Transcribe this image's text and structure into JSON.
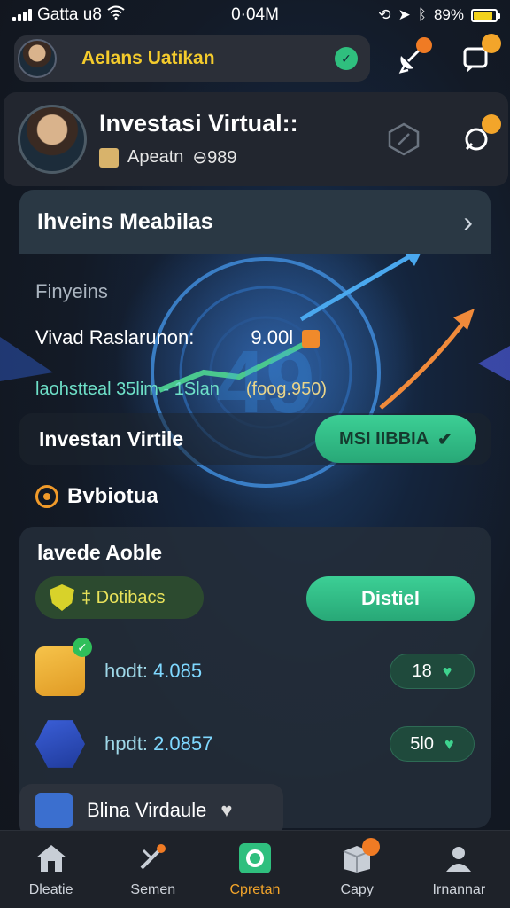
{
  "status_bar": {
    "carrier": "Gatta u8",
    "time": "0·04M",
    "battery_text": "89%",
    "battery_level": 0.89
  },
  "user": {
    "name": "Aelans Uatikan"
  },
  "profile": {
    "title": "Investasi Virtual::",
    "subtitle": "Apeatn",
    "code": "⊖989"
  },
  "panel": {
    "header_title": "Ihveins Meabilas",
    "subtitle": "Finyeins",
    "row1_label": "Vivad Raslarunon:",
    "row1_value": "9.00l",
    "row2_label": "laohstteal 35lim - 1Slan",
    "row2_value": "(foog.950)"
  },
  "invest": {
    "label": "Investan Virtile",
    "button_label": "MSI IIBBIA"
  },
  "section": {
    "title": "Bvbiotua"
  },
  "list": {
    "title": "lavede Aoble",
    "category_label": "‡ Dotibacs",
    "action_label": "Distiel",
    "items": [
      {
        "label": "hodt:",
        "value": "4.085",
        "badge": "18"
      },
      {
        "label": "hpdt:",
        "value": "2.0857",
        "badge": "5l0"
      }
    ]
  },
  "bottom_item": {
    "label": "Blina Virdaule"
  },
  "tabs": [
    {
      "label": "Dleatie",
      "icon": "home-icon"
    },
    {
      "label": "Semen",
      "icon": "tools-icon"
    },
    {
      "label": "Cpretan",
      "icon": "camera-icon"
    },
    {
      "label": "Capy",
      "icon": "box-icon"
    },
    {
      "label": "Irnannar",
      "icon": "person-icon"
    }
  ],
  "colors": {
    "accent_green": "#3ccf95",
    "accent_yellow": "#f4cb2c",
    "accent_orange": "#f3a52a",
    "background": "#131a26"
  }
}
